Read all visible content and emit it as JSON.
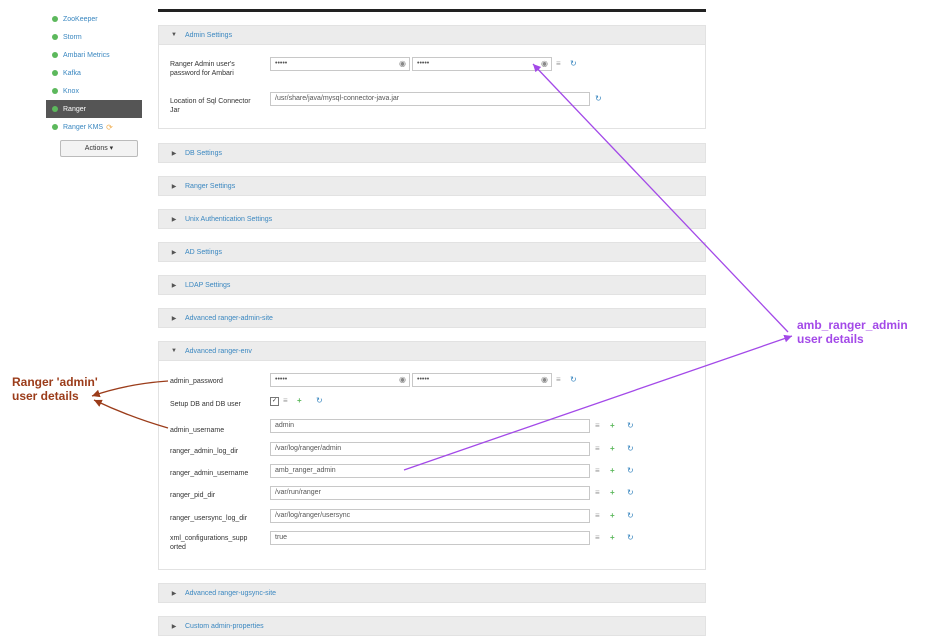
{
  "sidebar": {
    "services": [
      {
        "label": "ZooKeeper"
      },
      {
        "label": "Storm"
      },
      {
        "label": "Ambari Metrics"
      },
      {
        "label": "Kafka"
      },
      {
        "label": "Knox"
      },
      {
        "label": "Ranger",
        "active": true
      },
      {
        "label": "Ranger KMS"
      }
    ],
    "actions_label": "Actions ▾"
  },
  "admin_settings": {
    "title": "Admin Settings",
    "pw_label": "Ranger Admin user's password for Ambari",
    "pw_value": "•••••",
    "pw_confirm": "•••••",
    "jar_label": "Location of Sql Connector Jar",
    "jar_value": "/usr/share/java/mysql-connector-java.jar"
  },
  "collapsed_sections": [
    "DB Settings",
    "Ranger Settings",
    "Unix Authentication Settings",
    "AD Settings",
    "LDAP Settings",
    "Advanced ranger-admin-site"
  ],
  "ranger_env": {
    "title": "Advanced ranger-env",
    "admin_password_label": "admin_password",
    "admin_password_value": "•••••",
    "admin_password_confirm": "•••••",
    "setup_db_label": "Setup DB and DB user",
    "admin_username_label": "admin_username",
    "admin_username_value": "admin",
    "log_dir_label": "ranger_admin_log_dir",
    "log_dir_value": "/var/log/ranger/admin",
    "ranger_admin_username_label": "ranger_admin_username",
    "ranger_admin_username_value": "amb_ranger_admin",
    "pid_dir_label": "ranger_pid_dir",
    "pid_dir_value": "/var/run/ranger",
    "usersync_log_label": "ranger_usersync_log_dir",
    "usersync_log_value": "/var/log/ranger/usersync",
    "xml_label": "xml_configurations_supported",
    "xml_value": "true"
  },
  "bottom_sections": [
    "Advanced ranger-ugsync-site",
    "Custom admin-properties"
  ],
  "annotations": {
    "amb_line1": "amb_ranger_admin",
    "amb_line2": "user details",
    "ranger_line1": "Ranger 'admin'",
    "ranger_line2": "user details"
  },
  "colors": {
    "link": "#3a87c0",
    "annotation_purple": "#a349e8",
    "annotation_brown": "#9b3c1a",
    "ok_green": "#5cb85c"
  }
}
